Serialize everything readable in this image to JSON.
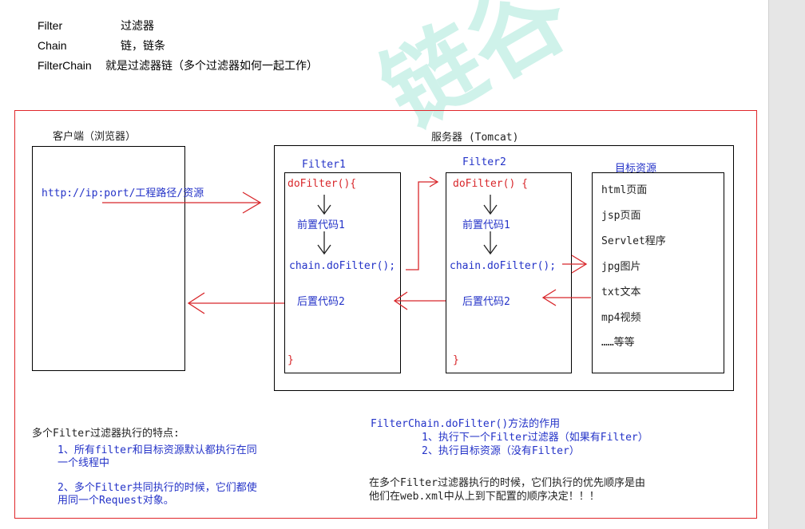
{
  "header": {
    "rows": [
      {
        "term": "Filter",
        "desc": "过滤器"
      },
      {
        "term": "Chain",
        "desc": "链，链条"
      },
      {
        "term": "FilterChain",
        "desc": "就是过滤器链（多个过滤器如何一起工作）"
      }
    ]
  },
  "watermark": {
    "text": "链谷"
  },
  "diagram": {
    "client_title": "客户端（浏览器）",
    "server_title": "服务器  (Tomcat)",
    "request_url": "http://ip:port/工程路径/资源",
    "filter1": {
      "title": "Filter1",
      "open": "doFilter(){",
      "pre": "前置代码1",
      "chain": "chain.doFilter();",
      "post": "后置代码2",
      "close": "}"
    },
    "filter2": {
      "title": "Filter2",
      "open": "doFilter() {",
      "pre": "前置代码1",
      "chain": "chain.doFilter();",
      "post": "后置代码2",
      "close": "}"
    },
    "resources": {
      "title": "目标资源",
      "items": [
        "html页面",
        "jsp页面",
        "Servlet程序",
        "jpg图片",
        "txt文本",
        "mp4视频",
        "……等等"
      ]
    }
  },
  "notes_left": {
    "title": "多个Filter过滤器执行的特点:",
    "p1_line1": "1、所有filter和目标资源默认都执行在同",
    "p1_line2": "一个线程中",
    "p2_line1": "2、多个Filter共同执行的时候，它们都使",
    "p2_line2": "用同一个Request对象。"
  },
  "notes_right": {
    "title": "FilterChain.doFilter()方法的作用",
    "item1": "1、执行下一个Filter过滤器（如果有Filter）",
    "item2": "2、执行目标资源（没有Filter）",
    "p_line1": "在多个Filter过滤器执行的时候，它们执行的优先顺序是由",
    "p_line2": "他们在web.xml中从上到下配置的顺序决定！！！"
  },
  "colors": {
    "red": "#d8262a",
    "blue": "#2433c8",
    "frame": "#e0262a",
    "watermark": "#bfeee4"
  }
}
